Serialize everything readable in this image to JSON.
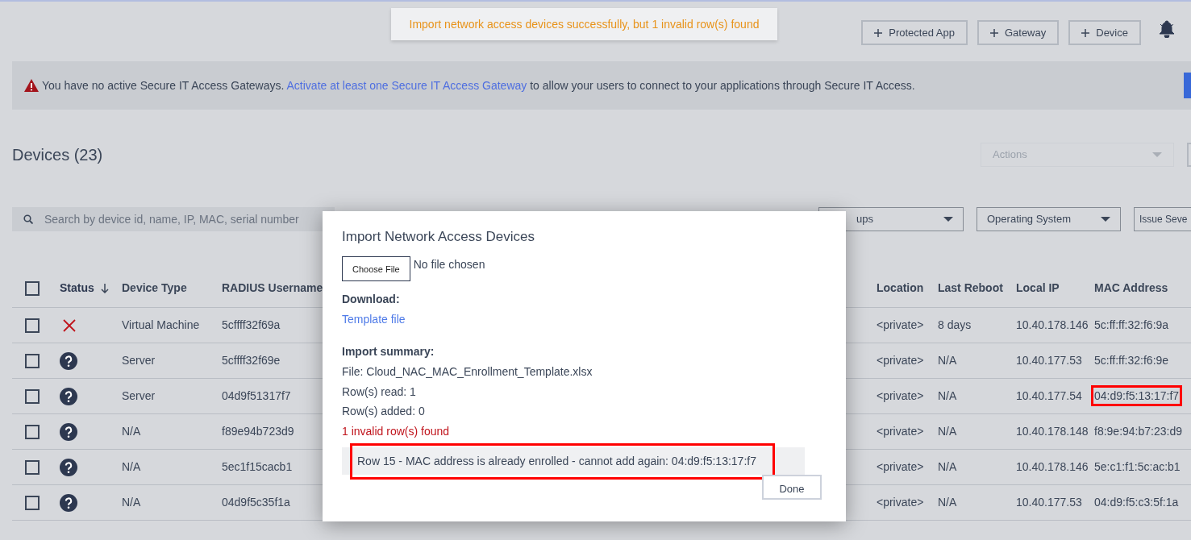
{
  "toast": {
    "message": "Import network access devices successfully, but 1 invalid row(s) found"
  },
  "header_buttons": [
    {
      "label": "Protected App"
    },
    {
      "label": "Gateway"
    },
    {
      "label": "Device"
    }
  ],
  "banner": {
    "text": "You have no active Secure IT Access Gateways.",
    "link": "Activate at least one Secure IT Access Gateway",
    "text_after": "to allow your users to connect to your applications through Secure IT Access."
  },
  "page_title": "Devices (23)",
  "actions_dropdown": {
    "placeholder": "Actions",
    "disabled": true
  },
  "search": {
    "placeholder": "Search by device id, name, IP, MAC, serial number"
  },
  "filters": [
    {
      "label": "ups"
    },
    {
      "label": "Operating System"
    },
    {
      "label": "Issue Seve"
    }
  ],
  "table": {
    "select_all_checked": false,
    "status_column": {
      "label": "Status",
      "sorted": true
    },
    "columns": [
      "Device Type",
      "RADIUS Username",
      "Location",
      "Last Reboot",
      "Local IP",
      "MAC Address"
    ],
    "rows": [
      {
        "checked": false,
        "kind": "error",
        "cells": [
          "Virtual Machine",
          "5cffff32f69a",
          "<private>",
          "8 days",
          "10.40.178.146",
          "5c:ff:ff:32:f6:9a"
        ],
        "mac_highlighted": false
      },
      {
        "checked": false,
        "kind": "unknown",
        "cells": [
          "Server",
          "5cffff32f69e",
          "<private>",
          "N/A",
          "10.40.177.53",
          "5c:ff:ff:32:f6:9e"
        ],
        "mac_highlighted": false
      },
      {
        "checked": false,
        "kind": "unknown",
        "cells": [
          "Server",
          "04d9f51317f7",
          "<private>",
          "N/A",
          "10.40.177.54",
          "04:d9:f5:13:17:f7"
        ],
        "mac_highlighted": true
      },
      {
        "checked": false,
        "kind": "unknown",
        "cells": [
          "N/A",
          "f89e94b723d9",
          "<private>",
          "N/A",
          "10.40.178.148",
          "f8:9e:94:b7:23:d9"
        ],
        "mac_highlighted": false
      },
      {
        "checked": false,
        "kind": "unknown",
        "cells": [
          "N/A",
          "5ec1f15cacb1",
          "<private>",
          "N/A",
          "10.40.178.146",
          "5e:c1:f1:5c:ac:b1"
        ],
        "mac_highlighted": false
      },
      {
        "checked": false,
        "kind": "unknown",
        "cells": [
          "N/A",
          "04d9f5c35f1a",
          "<private>",
          "N/A",
          "10.40.177.53",
          "04:d9:f5:c3:5f:1a"
        ],
        "mac_highlighted": false
      }
    ]
  },
  "modal": {
    "title": "Import Network Access Devices",
    "file_button": "Choose File",
    "file_status": "No file chosen",
    "download_label": "Download:",
    "download_link": "Template file",
    "summary_label": "Import summary:",
    "summary_lines": [
      "File: Cloud_NAC_MAC_Enrollment_Template.xlsx",
      "Row(s) read: 1",
      "Row(s) added: 0"
    ],
    "invalid_summary": "1 invalid row(s) found",
    "errors": [
      {
        "message": "Row 15 - MAC address is already enrolled - cannot add again: 04:d9:f5:13:17:f7",
        "highlighted": true
      }
    ],
    "done_button": "Done"
  }
}
